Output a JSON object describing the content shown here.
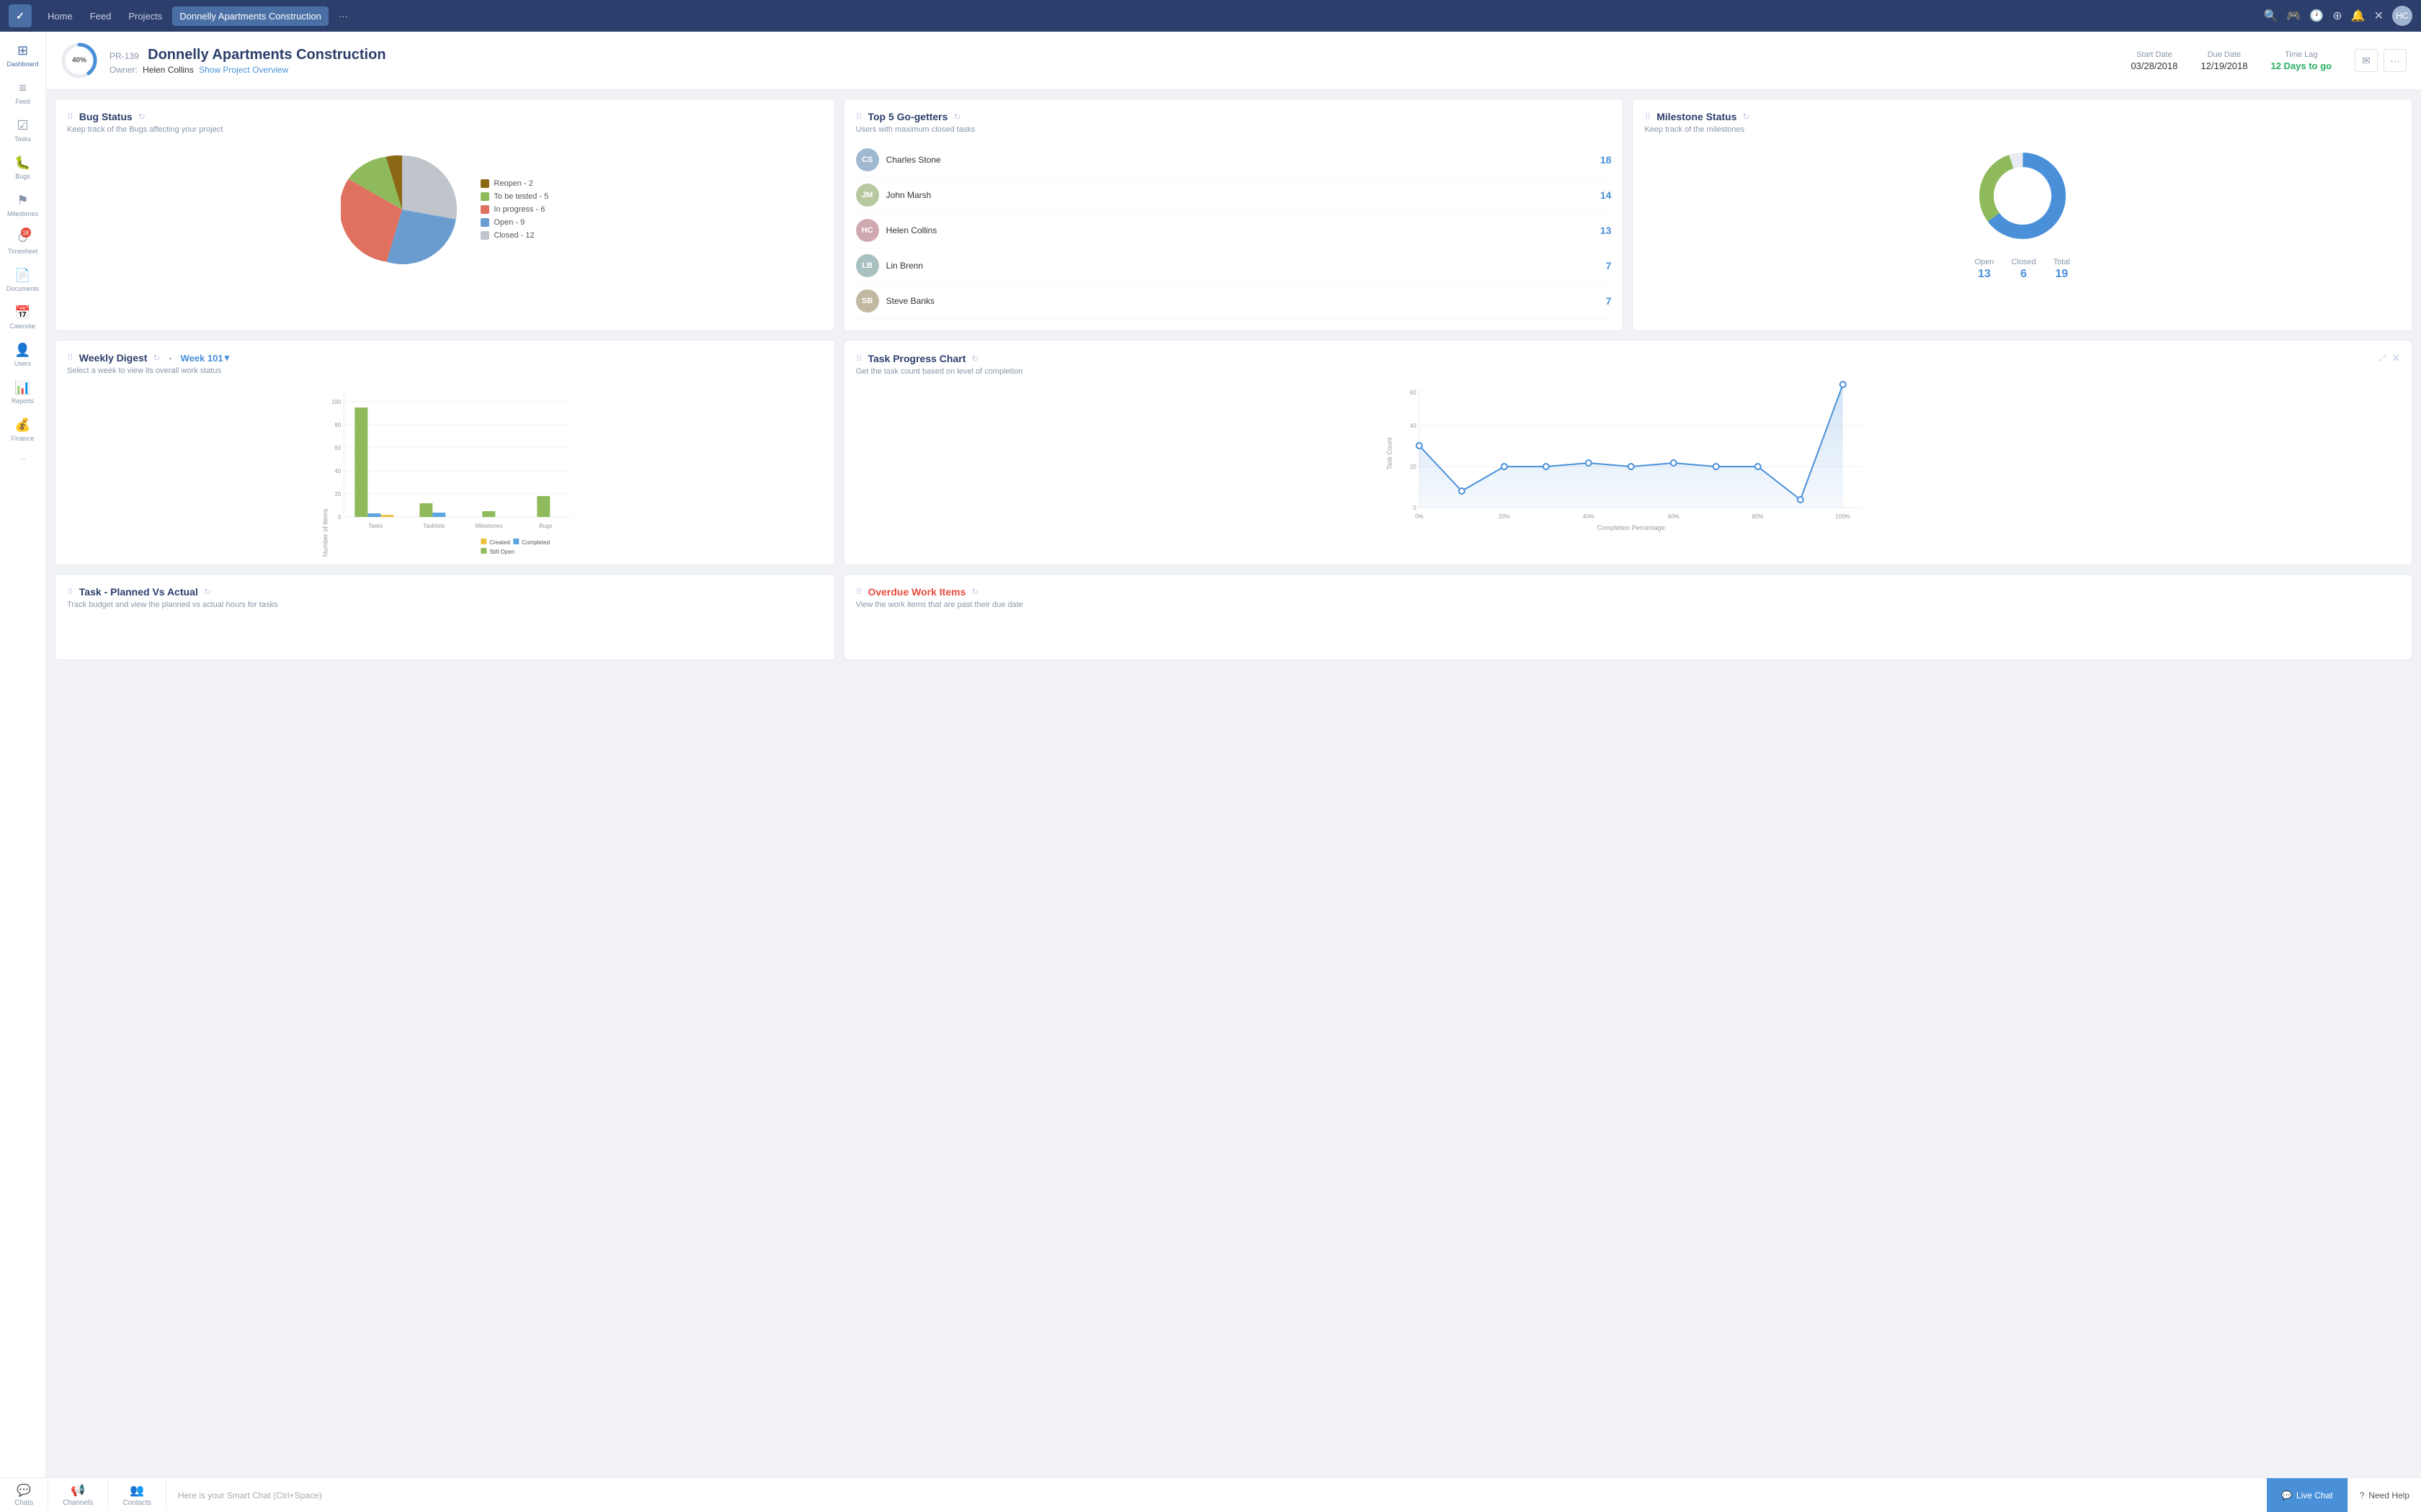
{
  "topnav": {
    "logo": "✓",
    "items": [
      {
        "label": "Home",
        "active": false
      },
      {
        "label": "Feed",
        "active": false
      },
      {
        "label": "Projects",
        "active": false
      },
      {
        "label": "Donnelly Apartments Construction",
        "active": true
      }
    ],
    "more": "···",
    "icons": [
      "🔍",
      "🎮",
      "🕐",
      "⊕",
      "🔔",
      "✕"
    ],
    "avatar_initials": "HC"
  },
  "sidebar": {
    "items": [
      {
        "label": "Dashboard",
        "icon": "⊞",
        "active": true
      },
      {
        "label": "Feed",
        "icon": "≡"
      },
      {
        "label": "Tasks",
        "icon": "☑"
      },
      {
        "label": "Bugs",
        "icon": "🐛"
      },
      {
        "label": "Milestones",
        "icon": "⚑"
      },
      {
        "label": "Timesheet",
        "icon": "⏱",
        "badge": "18"
      },
      {
        "label": "Documents",
        "icon": "📄"
      },
      {
        "label": "Calendar",
        "icon": "📅"
      },
      {
        "label": "Users",
        "icon": "👤"
      },
      {
        "label": "Reports",
        "icon": "📊"
      },
      {
        "label": "Finance",
        "icon": "💰"
      },
      {
        "label": "···",
        "icon": "···"
      }
    ]
  },
  "project_header": {
    "progress": 40,
    "progress_label": "40%",
    "id": "PR-139",
    "title": "Donnelly Apartments Construction",
    "owner_label": "Owner:",
    "owner": "Helen Collins",
    "show_overview": "Show Project Overview",
    "start_date_label": "Start Date",
    "start_date": "03/28/2018",
    "due_date_label": "Due Date",
    "due_date": "12/19/2018",
    "time_lag_label": "Time Lag",
    "time_lag": "12 Days to go"
  },
  "bug_status": {
    "title": "Bug Status",
    "subtitle": "Keep track of the Bugs affecting your project",
    "legend": [
      {
        "label": "Reopen - 2",
        "color": "#8B6914"
      },
      {
        "label": "To be tested - 5",
        "color": "#8fba5c"
      },
      {
        "label": "In progress - 6",
        "color": "#e07060"
      },
      {
        "label": "Open - 9",
        "color": "#6b9ccf"
      },
      {
        "label": "Closed - 12",
        "color": "#c0c5cc"
      }
    ],
    "slices": [
      {
        "label": "Reopen",
        "value": 2,
        "color": "#8B6914",
        "startAngle": 0,
        "endAngle": 42
      },
      {
        "label": "To be tested",
        "value": 5,
        "color": "#8fba5c",
        "startAngle": 42,
        "endAngle": 107
      },
      {
        "label": "In progress",
        "value": 6,
        "color": "#e07060",
        "startAngle": 107,
        "endAngle": 185
      },
      {
        "label": "Open",
        "value": 9,
        "color": "#6b9ccf",
        "startAngle": 185,
        "endAngle": 302
      },
      {
        "label": "Closed",
        "value": 12,
        "color": "#c0c5cc",
        "startAngle": 302,
        "endAngle": 360
      }
    ]
  },
  "top5": {
    "title": "Top 5 Go-getters",
    "subtitle": "Users with maximum closed tasks",
    "items": [
      {
        "name": "Charles Stone",
        "count": 18,
        "initials": "CS",
        "bg": "#a0b8d0"
      },
      {
        "name": "John Marsh",
        "count": 14,
        "initials": "JM",
        "bg": "#b8c8a0"
      },
      {
        "name": "Helen Collins",
        "count": 13,
        "initials": "HC",
        "bg": "#d0a8b0"
      },
      {
        "name": "Lin Brenn",
        "count": 7,
        "initials": "LB",
        "bg": "#a8c0c0"
      },
      {
        "name": "Steve Banks",
        "count": 7,
        "initials": "SB",
        "bg": "#c0b8a0"
      }
    ]
  },
  "milestone": {
    "title": "Milestone Status",
    "subtitle": "Keep track of the milestones",
    "open": 13,
    "closed": 6,
    "total": 19,
    "open_label": "Open",
    "closed_label": "Closed",
    "total_label": "Total",
    "open_color": "#4a90d9",
    "closed_color": "#8fba5c"
  },
  "weekly_digest": {
    "title": "Weekly Digest",
    "week": "Week 101",
    "subtitle": "Select a week to view its overall work status",
    "y_label": "Number of Items",
    "categories": [
      "Tasks",
      "Tasklists",
      "Milestones",
      "Bugs"
    ],
    "series": [
      {
        "label": "Created",
        "color": "#f0c040",
        "values": [
          2,
          0,
          0,
          0
        ]
      },
      {
        "label": "Completed",
        "color": "#5ba5e0",
        "values": [
          3,
          2,
          0,
          0
        ]
      },
      {
        "label": "Still Open",
        "color": "#8fba5c",
        "values": [
          95,
          12,
          5,
          18
        ]
      }
    ],
    "y_ticks": [
      0,
      20,
      40,
      60,
      80,
      100
    ]
  },
  "task_progress": {
    "title": "Task Progress Chart",
    "subtitle": "Get the task count based on level of completion",
    "x_label": "Completion Percentage",
    "y_label": "Task Count",
    "x_ticks": [
      "0%",
      "20%",
      "40%",
      "60%",
      "80%",
      "100%"
    ],
    "y_ticks": [
      0,
      20,
      40,
      60
    ],
    "data_points": [
      {
        "x": 0,
        "y": 30
      },
      {
        "x": 10,
        "y": 8
      },
      {
        "x": 20,
        "y": 20
      },
      {
        "x": 30,
        "y": 20
      },
      {
        "x": 40,
        "y": 22
      },
      {
        "x": 50,
        "y": 20
      },
      {
        "x": 60,
        "y": 22
      },
      {
        "x": 70,
        "y": 20
      },
      {
        "x": 80,
        "y": 20
      },
      {
        "x": 90,
        "y": 4
      },
      {
        "x": 100,
        "y": 62
      }
    ]
  },
  "planned_actual": {
    "title": "Task - Planned Vs Actual",
    "subtitle": "Track budget and view the planned vs actual hours for tasks"
  },
  "overdue": {
    "title": "Overdue Work Items",
    "subtitle": "View the work items that are past their due date"
  },
  "bottom_bar": {
    "tabs": [
      {
        "label": "Chats",
        "icon": "💬"
      },
      {
        "label": "Channels",
        "icon": "📢"
      },
      {
        "label": "Contacts",
        "icon": "👥"
      }
    ],
    "smart_chat_placeholder": "Here is your Smart Chat (Ctrl+Space)",
    "live_chat": "Live Chat",
    "need_help": "Need Help"
  }
}
